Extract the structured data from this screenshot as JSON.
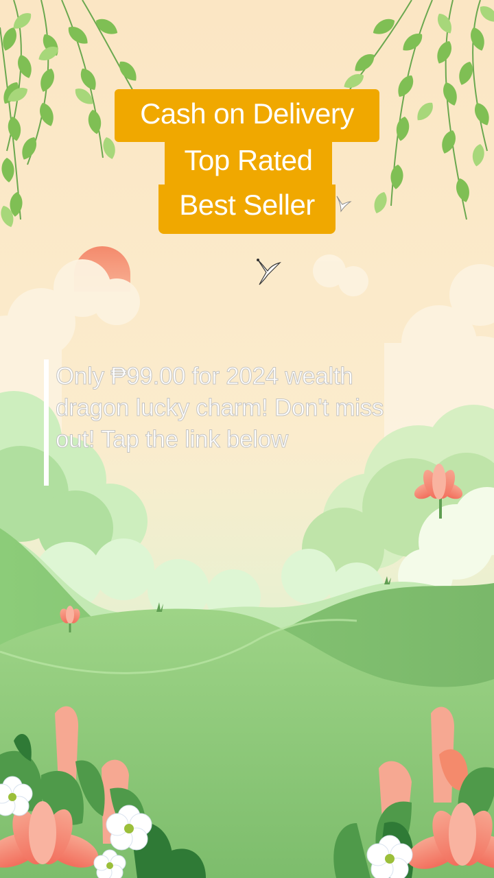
{
  "badges": {
    "cash_on_delivery": "Cash on Delivery",
    "top_rated": "Top Rated",
    "best_seller": "Best Seller"
  },
  "caption": {
    "text": "Only ₱99.00 for 2024 wealth dragon lucky charm! Don't miss out! Tap the link below"
  },
  "colors": {
    "badge_background": "#f0a800",
    "sky": "#fbe8c6",
    "hill_green": "#7fbf6c",
    "sun": "#f5987a"
  }
}
